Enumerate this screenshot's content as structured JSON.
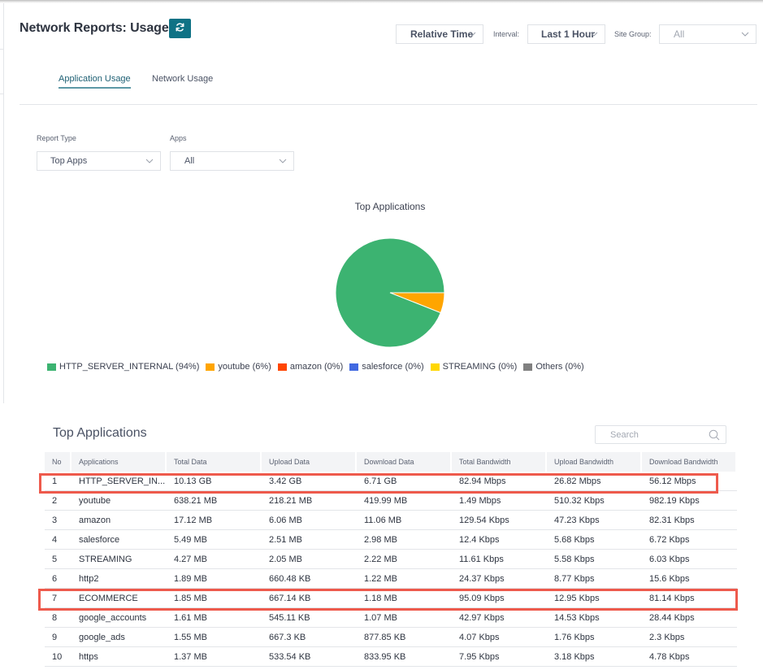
{
  "header": {
    "title": "Network Reports: Usage",
    "refresh_icon": "refresh-icon",
    "time_mode": "Relative Time",
    "interval_label": "Interval:",
    "interval_value": "Last 1 Hour",
    "site_group_label": "Site Group:",
    "site_group_value": "All"
  },
  "tabs": [
    {
      "label": "Application Usage",
      "active": true
    },
    {
      "label": "Network Usage",
      "active": false
    }
  ],
  "filters": {
    "report_type_label": "Report Type",
    "report_type_value": "Top Apps",
    "apps_label": "Apps",
    "apps_value": "All"
  },
  "chart_data": {
    "type": "pie",
    "title": "Top Applications",
    "legend_position": "bottom",
    "slices": [
      {
        "label": "HTTP_SERVER_INTERNAL",
        "percent": 94,
        "color": "#3cb371"
      },
      {
        "label": "youtube",
        "percent": 6,
        "color": "#ffa500"
      },
      {
        "label": "amazon",
        "percent": 0,
        "color": "#ff4500"
      },
      {
        "label": "salesforce",
        "percent": 0,
        "color": "#4169e1"
      },
      {
        "label": "STREAMING",
        "percent": 0,
        "color": "#ffd700"
      },
      {
        "label": "Others",
        "percent": 0,
        "color": "#808080"
      }
    ],
    "legend_texts": [
      "HTTP_SERVER_INTERNAL (94%)",
      "youtube (6%)",
      "amazon (0%)",
      "salesforce (0%)",
      "STREAMING (0%)",
      "Others (0%)"
    ]
  },
  "table": {
    "title": "Top Applications",
    "search_placeholder": "Search",
    "columns": [
      "No",
      "Applications",
      "Total Data",
      "Upload Data",
      "Download Data",
      "Total Bandwidth",
      "Upload Bandwidth",
      "Download Bandwidth"
    ],
    "rows": [
      [
        "1",
        "HTTP_SERVER_IN...",
        "10.13 GB",
        "3.42 GB",
        "6.71 GB",
        "82.94 Mbps",
        "26.82 Mbps",
        "56.12 Mbps"
      ],
      [
        "2",
        "youtube",
        "638.21 MB",
        "218.21 MB",
        "419.99 MB",
        "1.49 Mbps",
        "510.32 Kbps",
        "982.19 Kbps"
      ],
      [
        "3",
        "amazon",
        "17.12 MB",
        "6.06 MB",
        "11.06 MB",
        "129.54 Kbps",
        "47.23 Kbps",
        "82.31 Kbps"
      ],
      [
        "4",
        "salesforce",
        "5.49 MB",
        "2.51 MB",
        "2.98 MB",
        "12.4 Kbps",
        "5.68 Kbps",
        "6.72 Kbps"
      ],
      [
        "5",
        "STREAMING",
        "4.27 MB",
        "2.05 MB",
        "2.22 MB",
        "11.61 Kbps",
        "5.58 Kbps",
        "6.03 Kbps"
      ],
      [
        "6",
        "http2",
        "1.89 MB",
        "660.48 KB",
        "1.22 MB",
        "24.37 Kbps",
        "8.77 Kbps",
        "15.6 Kbps"
      ],
      [
        "7",
        "ECOMMERCE",
        "1.85 MB",
        "667.14 KB",
        "1.18 MB",
        "95.09 Kbps",
        "12.95 Kbps",
        "81.14 Kbps"
      ],
      [
        "8",
        "google_accounts",
        "1.61 MB",
        "545.11 KB",
        "1.07 MB",
        "42.97 Kbps",
        "14.53 Kbps",
        "28.44 Kbps"
      ],
      [
        "9",
        "google_ads",
        "1.55 MB",
        "667.3 KB",
        "877.85 KB",
        "4.07 Kbps",
        "1.76 Kbps",
        "2.3 Kbps"
      ],
      [
        "10",
        "https",
        "1.37 MB",
        "533.54 KB",
        "833.95 KB",
        "7.95 Kbps",
        "3.18 Kbps",
        "4.78 Kbps"
      ]
    ],
    "highlighted_rows": [
      "1",
      "7"
    ],
    "highlight_color": "#ee5a4c"
  },
  "colors": {
    "accent": "#0f7285",
    "tab_active": "#1d5f73"
  }
}
